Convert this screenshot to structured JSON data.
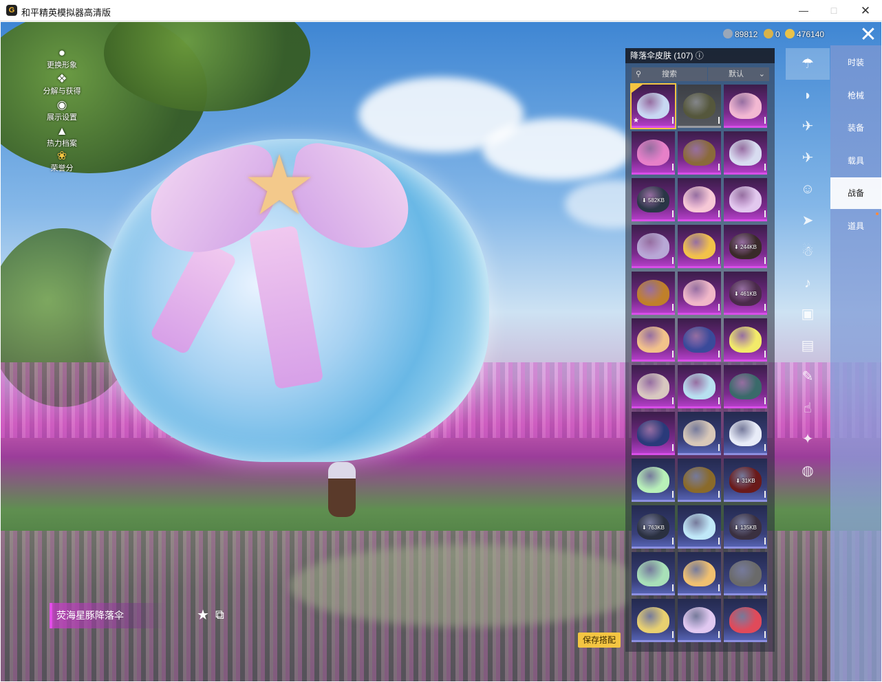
{
  "window": {
    "title": "和平精英模拟器高清版",
    "icon": "game-logo-icon",
    "controls": [
      "minimize-icon",
      "maximize-icon",
      "close-icon"
    ]
  },
  "left_menu": [
    {
      "label": "更换形象",
      "icon": "person-icon"
    },
    {
      "label": "分解与获得",
      "icon": "puzzle-icon"
    },
    {
      "label": "展示设置",
      "icon": "eye-icon"
    },
    {
      "label": "热力档案",
      "icon": "flame-icon"
    },
    {
      "label": "荣誉分",
      "icon": "laurel-icon"
    }
  ],
  "currencies": [
    {
      "value": "89812",
      "icon": "silver-coin-icon",
      "color": "#9aa7b8"
    },
    {
      "value": "0",
      "icon": "gold-badge-icon",
      "color": "#d8b24a"
    },
    {
      "value": "476140",
      "icon": "gold-coin-icon",
      "color": "#e9c24a"
    }
  ],
  "panel": {
    "title": "降落伞皮肤 (107)",
    "search_placeholder": "搜索",
    "sort_value": "默认",
    "items": [
      {
        "rarity": "purple",
        "color": "#c8d8f2",
        "selected": true
      },
      {
        "rarity": "gray",
        "color": "#55573c"
      },
      {
        "rarity": "purple",
        "color": "#f2b8d2"
      },
      {
        "rarity": "purple",
        "color": "#e680c8"
      },
      {
        "rarity": "purple",
        "color": "#8a6a3a"
      },
      {
        "rarity": "purple",
        "color": "#d8dcf0"
      },
      {
        "rarity": "purple",
        "color": "#2a3646",
        "download": "582KB"
      },
      {
        "rarity": "purple",
        "color": "#f6c8d6"
      },
      {
        "rarity": "purple",
        "color": "#e2c8ee"
      },
      {
        "rarity": "purple",
        "color": "#b8a8d6"
      },
      {
        "rarity": "purple",
        "color": "#f2c24a"
      },
      {
        "rarity": "purple",
        "color": "#3a2a2a",
        "download": "244KB"
      },
      {
        "rarity": "purple",
        "color": "#c0802a"
      },
      {
        "rarity": "purple",
        "color": "#f0b8c8"
      },
      {
        "rarity": "purple",
        "color": "#4a2a4a",
        "download": "461KB"
      },
      {
        "rarity": "purple",
        "color": "#f2c28a"
      },
      {
        "rarity": "purple",
        "color": "#3a4a9a"
      },
      {
        "rarity": "purple",
        "color": "#f2ea6a"
      },
      {
        "rarity": "purple",
        "color": "#d8c8c0"
      },
      {
        "rarity": "purple",
        "color": "#b8e0f0"
      },
      {
        "rarity": "purple",
        "color": "#3a6a6a"
      },
      {
        "rarity": "purple",
        "color": "#2a3a7a"
      },
      {
        "rarity": "blue",
        "color": "#d8c8b8"
      },
      {
        "rarity": "blue",
        "color": "#e8ecf8"
      },
      {
        "rarity": "blue",
        "color": "#b8f0b8"
      },
      {
        "rarity": "blue",
        "color": "#8a6a2a"
      },
      {
        "rarity": "blue",
        "color": "#6a1a1a",
        "download": "31KB"
      },
      {
        "rarity": "blue",
        "color": "#2a3040",
        "download": "763KB"
      },
      {
        "rarity": "blue",
        "color": "#c0e8f8"
      },
      {
        "rarity": "blue",
        "color": "#3a3040",
        "download": "135KB"
      },
      {
        "rarity": "blue",
        "color": "#a8e0b8"
      },
      {
        "rarity": "blue",
        "color": "#f0c070"
      },
      {
        "rarity": "blue",
        "color": "#6a6a6a"
      },
      {
        "rarity": "blue",
        "color": "#e8d070"
      },
      {
        "rarity": "blue",
        "color": "#e0c8f0"
      },
      {
        "rarity": "blue",
        "color": "#e04a5a"
      }
    ]
  },
  "categories": [
    {
      "icon": "parachute-icon",
      "active": true
    },
    {
      "icon": "bag-icon"
    },
    {
      "icon": "glider-icon"
    },
    {
      "icon": "plane-icon"
    },
    {
      "icon": "emote-icon"
    },
    {
      "icon": "jet-icon"
    },
    {
      "icon": "pet-icon"
    },
    {
      "icon": "speaker-icon"
    },
    {
      "icon": "chest-icon"
    },
    {
      "icon": "photo-frame-icon"
    },
    {
      "icon": "spray-icon"
    },
    {
      "icon": "hand-icon"
    },
    {
      "icon": "wand-icon"
    },
    {
      "icon": "saucer-icon"
    }
  ],
  "tabs": [
    "时装",
    "枪械",
    "装备",
    "载具",
    "战备",
    "道具"
  ],
  "active_tab": "战备",
  "item_name": "荧海星豚降落伞",
  "save_label": "保存搭配"
}
